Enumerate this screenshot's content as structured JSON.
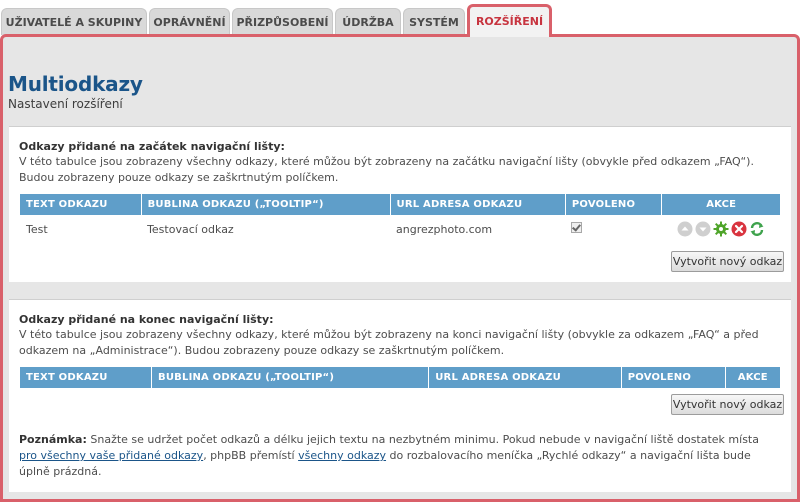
{
  "tabs": [
    {
      "label": "UŽIVATELÉ A SKUPINY"
    },
    {
      "label": "OPRÁVNĚNÍ"
    },
    {
      "label": "PŘIZPŮSOBENÍ"
    },
    {
      "label": "ÚDRŽBA"
    },
    {
      "label": "SYSTÉM"
    },
    {
      "label": "ROZŠÍŘENÍ",
      "active": true
    }
  ],
  "page": {
    "title": "Multiodkazy",
    "subtitle": "Nastavení rozšíření"
  },
  "columns": {
    "text": "TEXT ODKAZU",
    "tooltip": "BUBLINA ODKAZU („TOOLTIP“)",
    "url": "URL ADRESA ODKAZU",
    "enabled": "POVOLENO",
    "actions": "AKCE"
  },
  "section_start": {
    "heading": "Odkazy přidané na začátek navigační lišty:",
    "description": "V této tabulce jsou zobrazeny všechny odkazy, které můžou být zobrazeny na začátku navigační lišty (obvykle před odkazem „FAQ“). Budou zobrazeny pouze odkazy se zaškrtnutým políčkem.",
    "rows": [
      {
        "text": "Test",
        "tooltip": "Testovací odkaz",
        "url": "angrezphoto.com",
        "enabled": true
      }
    ],
    "create_button": "Vytvořit nový odkaz"
  },
  "section_end": {
    "heading": "Odkazy přidané na konec navigační lišty:",
    "description": "V této tabulce jsou zobrazeny všechny odkazy, které můžou být zobrazeny na konci navigační lišty (obvykle za odkazem „FAQ“ a před odkazem na „Administrace“). Budou zobrazeny pouze odkazy se zaškrtnutým políčkem.",
    "rows": [],
    "create_button": "Vytvořit nový odkaz"
  },
  "note": {
    "label": "Poznámka:",
    "text_1": " Snažte se udržet počet odkazů a délku jejich textu na nezbytném minimu. Pokud nebude v navigační liště dostatek místa ",
    "link_1": "pro všechny vaše přidané odkazy",
    "text_2": ", phpBB přemístí ",
    "link_2": "všechny odkazy",
    "text_3": " do rozbalovacího meníčka „Rychlé odkazy“ a navigační lišta bude úplně prázdná."
  },
  "icons": {
    "move_up": "arrow-up-icon",
    "move_down": "arrow-down-icon",
    "edit": "gear-icon",
    "delete": "delete-icon",
    "sync": "refresh-icon"
  },
  "colors": {
    "accent": "#d9606a",
    "header": "#5f9ec9",
    "title": "#1b5589"
  }
}
